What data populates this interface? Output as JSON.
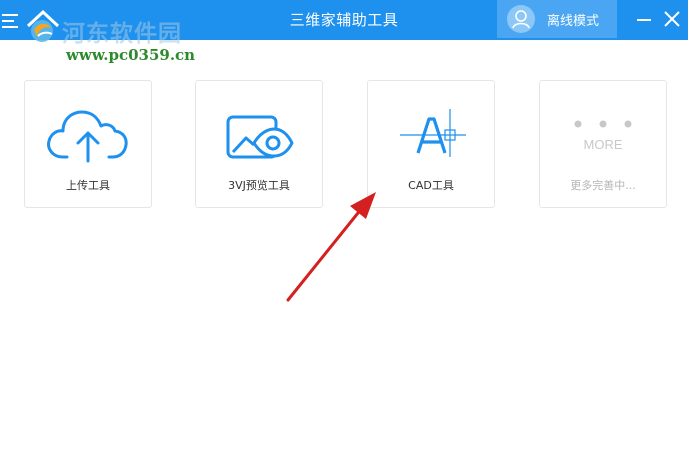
{
  "window": {
    "title": "三维家辅助工具",
    "mode_label": "离线模式",
    "accent_color": "#1e90ee"
  },
  "watermark": {
    "name": "河东软件园",
    "url": "www.pc0359.cn"
  },
  "tools": [
    {
      "label": "上传工具",
      "icon": "cloud-upload-icon"
    },
    {
      "label": "3VJ预览工具",
      "icon": "eye-preview-icon"
    },
    {
      "label": "CAD工具",
      "icon": "cad-a-icon"
    },
    {
      "label": "更多完善中...",
      "icon": "more-dots-icon",
      "icon_text": "MORE",
      "disabled": true
    }
  ],
  "annotation": {
    "color": "#d42020",
    "icon": "red-arrow"
  }
}
